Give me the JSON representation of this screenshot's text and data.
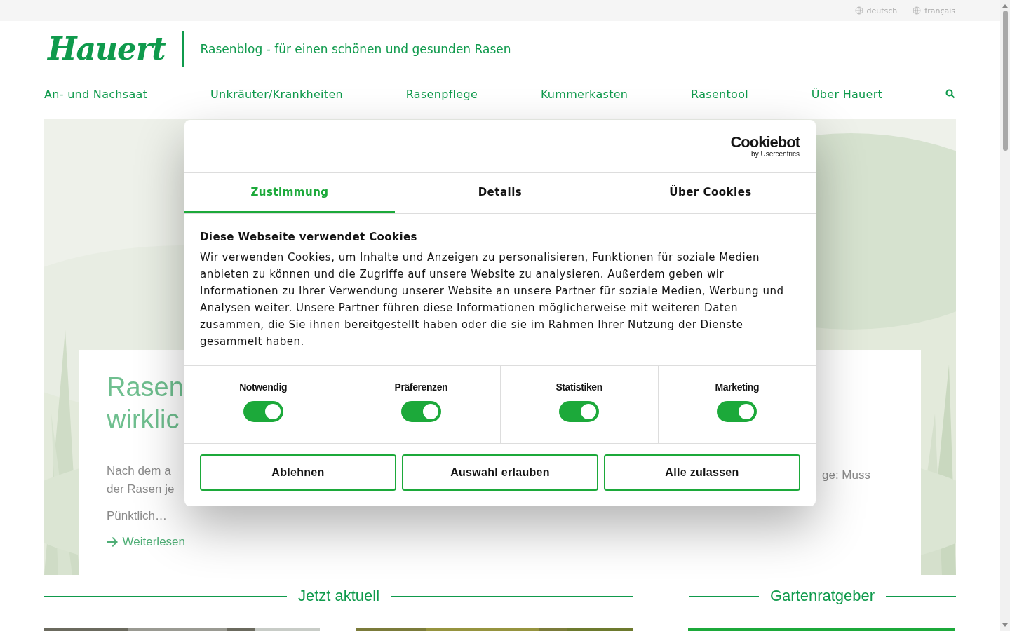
{
  "languages": [
    {
      "label": "deutsch"
    },
    {
      "label": "français"
    }
  ],
  "header": {
    "logo": "Hauert",
    "tagline": "Rasenblog - für einen schönen und gesunden Rasen"
  },
  "nav": [
    "An- und Nachsaat",
    "Unkräuter/Krankheiten",
    "Rasenpflege",
    "Kummerkasten",
    "Rasentool",
    "Über Hauert"
  ],
  "hero": {
    "title_lines": [
      "Rasen",
      "wirklic"
    ],
    "text_lines": [
      "Nach dem a",
      "der Rasen je"
    ],
    "text_right": "ge: Muss",
    "teaser": "Pünktlich…",
    "link": "Weiterlesen"
  },
  "sections": [
    {
      "title": "Jetzt aktuell"
    },
    {
      "title": "Gartenratgeber"
    }
  ],
  "cookie_dialog": {
    "brand": "Cookiebot",
    "brand_sub": "by Usercentrics",
    "tabs": [
      {
        "label": "Zustimmung",
        "selected": true
      },
      {
        "label": "Details",
        "selected": false
      },
      {
        "label": "Über Cookies",
        "selected": false
      }
    ],
    "title": "Diese Webseite verwendet Cookies",
    "text": "Wir verwenden Cookies, um Inhalte und Anzeigen zu personalisieren, Funktionen für soziale Medien anbieten zu können und die Zugriffe auf unsere Website zu analysieren. Außerdem geben wir Informationen zu Ihrer Verwendung unserer Website an unsere Partner für soziale Medien, Werbung und Analysen weiter. Unsere Partner führen diese Informationen möglicherweise mit weiteren Daten zusammen, die Sie ihnen bereitgestellt haben oder die sie im Rahmen Ihrer Nutzung der Dienste gesammelt haben.",
    "categories": [
      {
        "label": "Notwendig",
        "checked": true
      },
      {
        "label": "Präferenzen",
        "checked": true
      },
      {
        "label": "Statistiken",
        "checked": true
      },
      {
        "label": "Marketing",
        "checked": true
      }
    ],
    "buttons": [
      "Ablehnen",
      "Auswahl erlauben",
      "Alle zulassen"
    ]
  }
}
